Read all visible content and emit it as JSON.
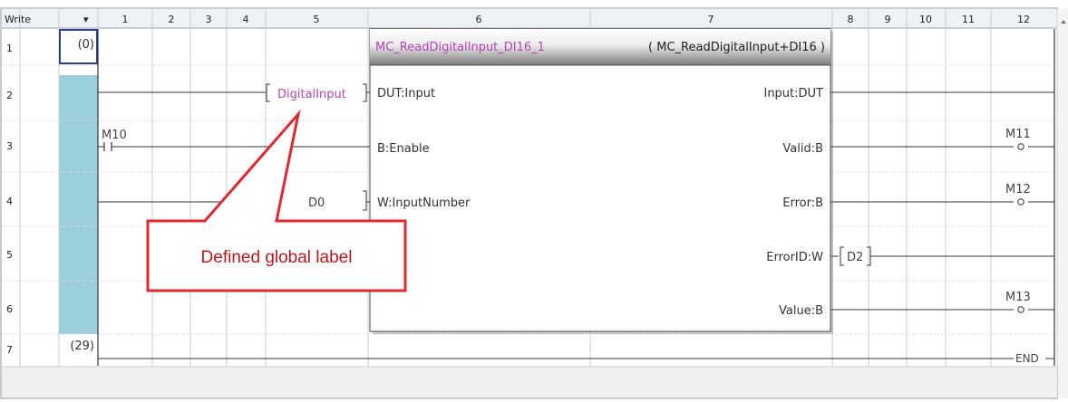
{
  "header": {
    "mode_label": "Write",
    "dropdown_glyph": "▾",
    "columns": [
      "1",
      "2",
      "3",
      "4",
      "5",
      "6",
      "7",
      "8",
      "9",
      "10",
      "11",
      "12"
    ]
  },
  "rows": [
    {
      "number": "1",
      "step": "(0)"
    },
    {
      "number": "2",
      "step": ""
    },
    {
      "number": "3",
      "step": ""
    },
    {
      "number": "4",
      "step": ""
    },
    {
      "number": "5",
      "step": ""
    },
    {
      "number": "6",
      "step": ""
    },
    {
      "number": "7",
      "step": "(29)"
    }
  ],
  "ladder": {
    "contact_m10": "M10",
    "operand_digital_input": "DigitalInput",
    "operand_d0": "D0",
    "operand_d2": "D2",
    "coil_m11": "M11",
    "coil_m12": "M12",
    "coil_m13": "M13",
    "end_label": "END"
  },
  "function_block": {
    "instance_name": "MC_ReadDigitalInput_DI16_1",
    "type_name": "( MC_ReadDigitalInput+DI16 )",
    "inputs": [
      "DUT:Input",
      "B:Enable",
      "W:InputNumber"
    ],
    "outputs": [
      "Input:DUT",
      "Valid:B",
      "Error:B",
      "ErrorID:W",
      "Value:B"
    ]
  },
  "callout": {
    "text": "Defined global label"
  },
  "colors": {
    "selected_column": "#9ccfdc",
    "callout_border": "#e0282e",
    "callout_text": "#c0171e",
    "instance_name": "#b347b3",
    "digital_input": "#b347b3",
    "header_bg": "#eef1f5"
  }
}
